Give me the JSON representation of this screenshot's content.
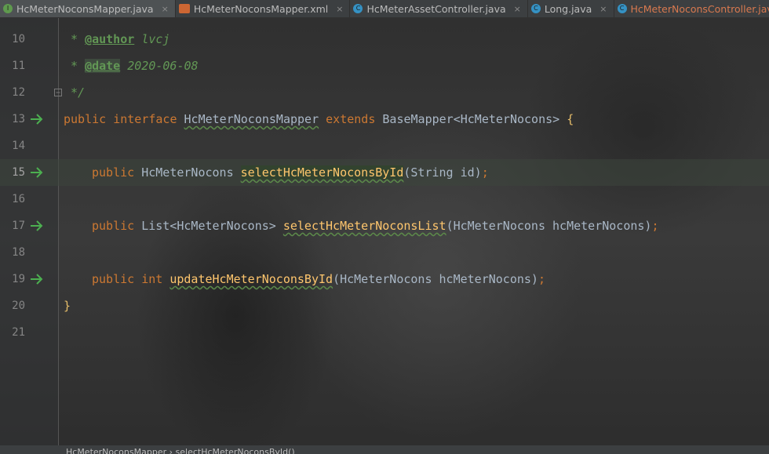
{
  "tabs": [
    {
      "label": "HcMeterNoconsMapper.java",
      "icon": "interface-icon",
      "active": true
    },
    {
      "label": "HcMeterNoconsMapper.xml",
      "icon": "xml-file-icon",
      "active": false
    },
    {
      "label": "HcMeterAssetController.java",
      "icon": "class-icon",
      "active": false
    },
    {
      "label": "Long.java",
      "icon": "class-icon",
      "active": false
    },
    {
      "label": "HcMeterNoconsController.java",
      "icon": "class-icon",
      "active": false
    }
  ],
  "editor": {
    "lines": {
      "l10": {
        "num": "10",
        "star": "*",
        "tag": "@author",
        "text": "lvcj"
      },
      "l11": {
        "num": "11",
        "star": "*",
        "tag": "@date",
        "text": "2020-06-08"
      },
      "l12": {
        "num": "12",
        "text": "*/"
      },
      "l13": {
        "num": "13",
        "kw1": "public",
        "kw2": "interface",
        "name": "HcMeterNoconsMapper",
        "kw3": "extends",
        "type": "BaseMapper<HcMeterNocons>",
        "brace": "{"
      },
      "l14": {
        "num": "14"
      },
      "l15": {
        "num": "15",
        "kw1": "public",
        "type": "HcMeterNocons",
        "method": "selectHcMeterNoconsById",
        "params": "(String id)",
        "end": ";"
      },
      "l16": {
        "num": "16"
      },
      "l17": {
        "num": "17",
        "kw1": "public",
        "type": "List<HcMeterNocons>",
        "method": "selectHcMeterNoconsList",
        "params": "(HcMeterNocons hcMeterNocons)",
        "end": ";"
      },
      "l18": {
        "num": "18"
      },
      "l19": {
        "num": "19",
        "kw1": "public",
        "kw2": "int",
        "method": "updateHcMeterNoconsById",
        "params": "(HcMeterNocons hcMeterNocons)",
        "end": ";"
      },
      "l20": {
        "num": "20",
        "brace": "}"
      },
      "l21": {
        "num": "21"
      }
    }
  },
  "breadcrumb": {
    "interface": "HcMeterNoconsMapper",
    "sep": "›",
    "method": "selectHcMeterNoconsById()"
  },
  "colors": {
    "keyword": "#cc7832",
    "method": "#ffc66d",
    "doc": "#629755",
    "text": "#a9b7c6",
    "gutter_arrow": "#4caf50"
  }
}
